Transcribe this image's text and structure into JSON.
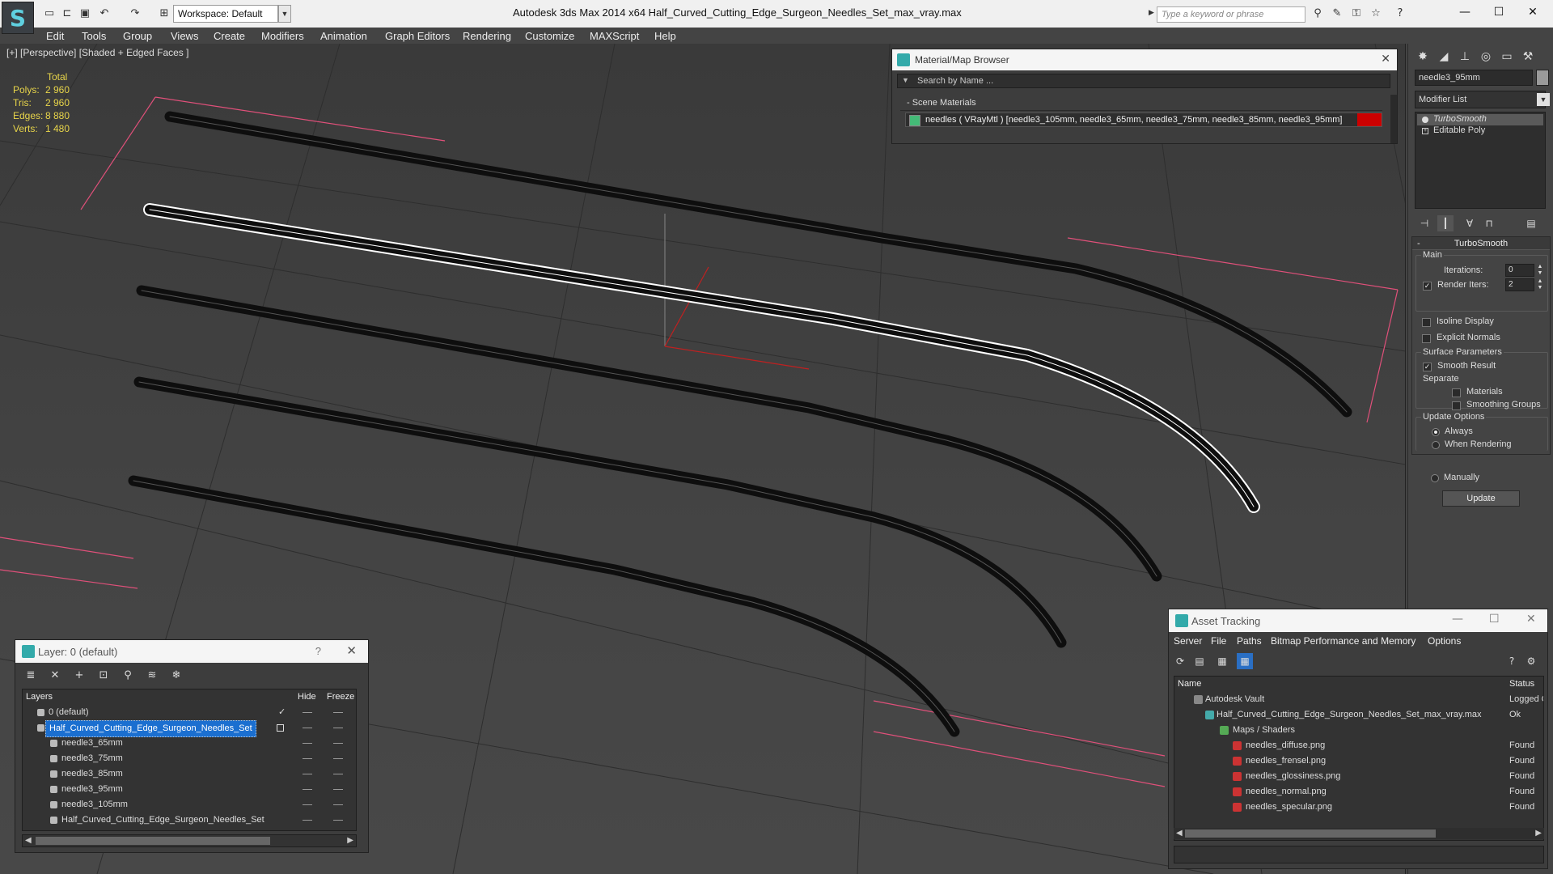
{
  "titlebar": {
    "workspace": "Workspace: Default",
    "title": "Autodesk 3ds Max  2014 x64      Half_Curved_Cutting_Edge_Surgeon_Needles_Set_max_vray.max",
    "search_placeholder": "Type a keyword or phrase",
    "quick_access_icons": [
      "new-icon",
      "open-icon",
      "save-icon",
      "undo-icon",
      "redo-icon",
      "project-icon"
    ]
  },
  "menu": [
    "Edit",
    "Tools",
    "Group",
    "Views",
    "Create",
    "Modifiers",
    "Animation",
    "Graph Editors",
    "Rendering",
    "Customize",
    "MAXScript",
    "Help"
  ],
  "viewport": {
    "label": "[+] [Perspective] [Shaded + Edged Faces ]",
    "stats": {
      "total_label": "Total",
      "rows": [
        {
          "label": "Polys:",
          "value": "2 960"
        },
        {
          "label": "Tris:",
          "value": "2 960"
        },
        {
          "label": "Edges:",
          "value": "8 880"
        },
        {
          "label": "Verts:",
          "value": "1 480"
        }
      ]
    }
  },
  "material_browser": {
    "title": "Material/Map Browser",
    "search_placeholder": "Search by Name ...",
    "section": "- Scene Materials",
    "material_row": "needles  ( VRayMtl )  [needle3_105mm, needle3_65mm, needle3_75mm, needle3_85mm, needle3_95mm]"
  },
  "command_panel": {
    "object_name": "needle3_95mm",
    "modifier_list": "Modifier List",
    "stack": [
      "TurboSmooth",
      "Editable Poly"
    ],
    "rollout_title": "TurboSmooth",
    "main_group": "Main",
    "iterations_label": "Iterations:",
    "iterations_value": "0",
    "render_iters_label": "Render Iters:",
    "render_iters_value": "2",
    "isoline_label": "Isoline Display",
    "explicit_normals_label": "Explicit Normals",
    "surface_group": "Surface Parameters",
    "smooth_result_label": "Smooth Result",
    "separate_label": "Separate",
    "materials_label": "Materials",
    "smoothing_groups_label": "Smoothing Groups",
    "update_group": "Update Options",
    "always_label": "Always",
    "when_rendering_label": "When Rendering",
    "manually_label": "Manually",
    "update_button": "Update"
  },
  "layer_dialog": {
    "title": "Layer: 0 (default)",
    "help": "?",
    "col_layers": "Layers",
    "col_hide": "Hide",
    "col_freeze": "Freeze",
    "rows": [
      {
        "name": "0 (default)",
        "level": 0
      },
      {
        "name": "Half_Curved_Cutting_Edge_Surgeon_Needles_Set",
        "level": 0
      },
      {
        "name": "needle3_65mm",
        "level": 1
      },
      {
        "name": "needle3_75mm",
        "level": 1
      },
      {
        "name": "needle3_85mm",
        "level": 1
      },
      {
        "name": "needle3_95mm",
        "level": 1
      },
      {
        "name": "needle3_105mm",
        "level": 1
      },
      {
        "name": "Half_Curved_Cutting_Edge_Surgeon_Needles_Set",
        "level": 1
      }
    ]
  },
  "asset_tracking": {
    "title": "Asset Tracking",
    "menu": [
      "Server",
      "File",
      "Paths",
      "Bitmap Performance and Memory",
      "Options"
    ],
    "col_name": "Name",
    "col_status": "Status",
    "rows": [
      {
        "name": "Autodesk Vault",
        "status": "Logged O",
        "level": 1
      },
      {
        "name": "Half_Curved_Cutting_Edge_Surgeon_Needles_Set_max_vray.max",
        "status": "Ok",
        "level": 2
      },
      {
        "name": "Maps / Shaders",
        "status": "",
        "level": 3
      },
      {
        "name": "needles_diffuse.png",
        "status": "Found",
        "level": 4
      },
      {
        "name": "needles_frensel.png",
        "status": "Found",
        "level": 4
      },
      {
        "name": "needles_glossiness.png",
        "status": "Found",
        "level": 4
      },
      {
        "name": "needles_normal.png",
        "status": "Found",
        "level": 4
      },
      {
        "name": "needles_specular.png",
        "status": "Found",
        "level": 4
      }
    ]
  },
  "colors": {
    "stats_yellow": "#e8d54a",
    "selection_blue": "#1b6fd0",
    "bounding_pink": "#e0507a",
    "material_red": "#cc0000"
  }
}
